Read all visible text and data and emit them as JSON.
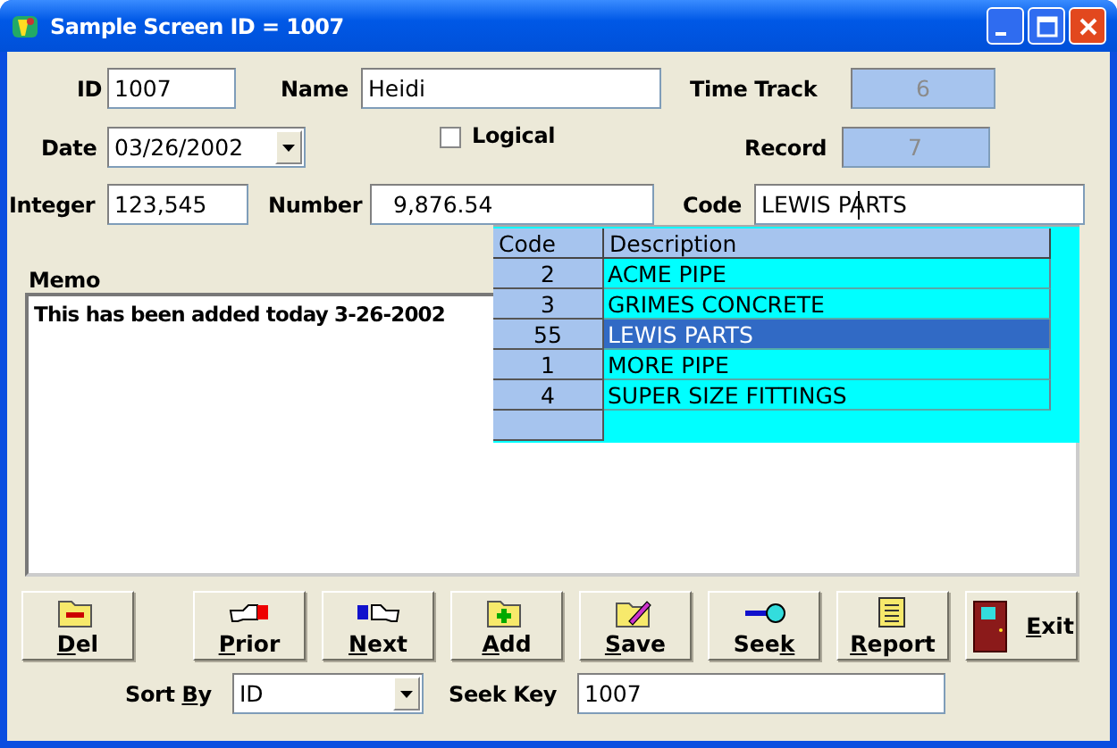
{
  "window": {
    "title": "Sample Screen ID = 1007"
  },
  "id": {
    "label": "ID",
    "value": "1007"
  },
  "name": {
    "label": "Name",
    "value": "Heidi"
  },
  "time_track": {
    "label": "Time Track",
    "value": "6",
    "disabled": true
  },
  "date": {
    "label": "Date",
    "value": "03/26/2002"
  },
  "logical": {
    "label": "Logical",
    "checked": false
  },
  "record": {
    "label": "Record",
    "value": "7",
    "disabled": true
  },
  "integer": {
    "label": "Integer",
    "value": "123,545"
  },
  "number": {
    "label": "Number",
    "value": "9,876.54"
  },
  "code": {
    "label": "Code",
    "value": "LEWIS PARTS"
  },
  "memo": {
    "label": "Memo",
    "value": "This has been added today 3-26-2002"
  },
  "lookup": {
    "columns": [
      "Code",
      "Description"
    ],
    "rows": [
      {
        "code": "2",
        "description": "ACME PIPE",
        "selected": false
      },
      {
        "code": "3",
        "description": "GRIMES CONCRETE",
        "selected": false
      },
      {
        "code": "55",
        "description": "LEWIS PARTS",
        "selected": true
      },
      {
        "code": "1",
        "description": "MORE PIPE",
        "selected": false
      },
      {
        "code": "4",
        "description": "SUPER SIZE FITTINGS",
        "selected": false
      }
    ]
  },
  "buttons": [
    {
      "key": "D",
      "post": "el"
    },
    {
      "key": "P",
      "post": "rior"
    },
    {
      "key": "N",
      "post": "ext"
    },
    {
      "key": "A",
      "post": "dd"
    },
    {
      "key": "S",
      "post": "ave"
    },
    {
      "pre": "See",
      "key": "k"
    },
    {
      "key": "R",
      "post": "eport"
    },
    {
      "key": "E",
      "post": "xit"
    }
  ],
  "sort_by": {
    "pre": "Sort ",
    "key": "B",
    "post": "y",
    "value": "ID"
  },
  "seek_key": {
    "label": "Seek Key",
    "value": "1007"
  }
}
